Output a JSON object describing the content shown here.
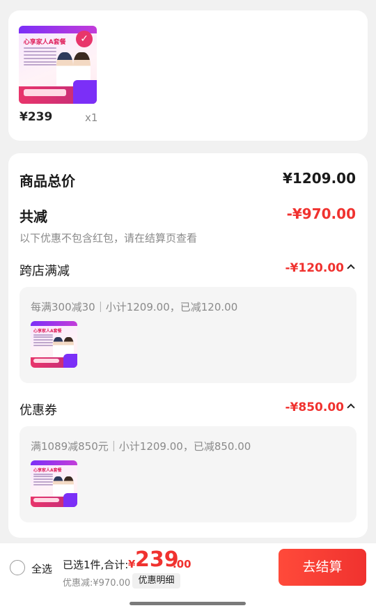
{
  "cart": {
    "product": {
      "image_text": "心享家人A套餐",
      "price": "¥239",
      "quantity": "x1",
      "checked_icon": "check-icon"
    }
  },
  "summary": {
    "total_label": "商品总价",
    "total_value": "¥1209.00",
    "discount_label": "共减",
    "discount_value": "-¥970.00",
    "hint": "以下优惠不包含红包，请在结算页查看",
    "cross_store": {
      "label": "跨店满减",
      "value": "-¥120.00",
      "rule": "每满300减30｜小计1209.00，已减120.00"
    },
    "coupon": {
      "label": "优惠券",
      "value": "-¥850.00",
      "rule": "满1089减850元｜小计1209.00，已减850.00"
    }
  },
  "bottom_bar": {
    "select_all": "全选",
    "selected_text": "已选1件,合计:",
    "currency": "¥",
    "total_int": "239",
    "total_dec": ".00",
    "saved_text": "优惠减:¥970.00",
    "detail_button": "优惠明细",
    "checkout_button": "去结算"
  },
  "colors": {
    "accent_red": "#f0322f",
    "background": "#f1f1f1"
  }
}
